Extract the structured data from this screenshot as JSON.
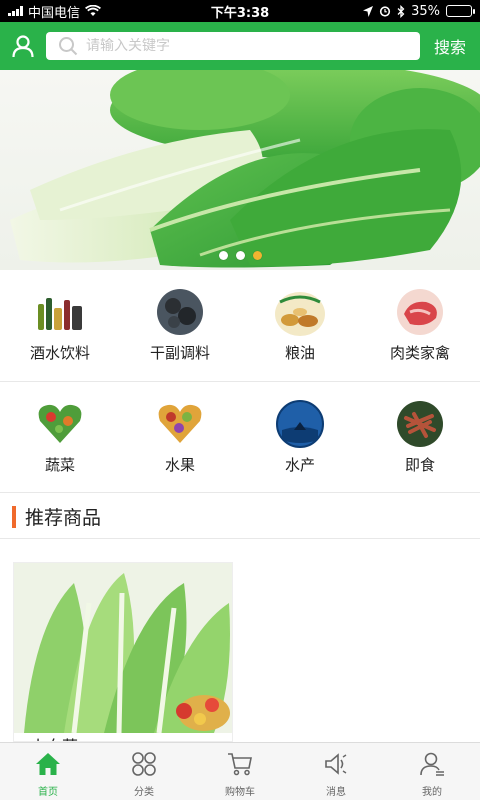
{
  "status_bar": {
    "carrier": "中国电信",
    "time": "下午3:38",
    "battery": "35%",
    "battery_level": 0.35,
    "icons": [
      "signal-icon",
      "wifi-icon",
      "location-icon",
      "alarm-icon",
      "bluetooth-icon",
      "battery-icon"
    ]
  },
  "header": {
    "search_placeholder": "请输入关键字",
    "search_button": "搜索",
    "accent_color": "#2ab24a"
  },
  "banner": {
    "slide_count": 3,
    "active_slide": 3
  },
  "categories": [
    {
      "label": "酒水饮料",
      "icon": "drinks-icon"
    },
    {
      "label": "干副调料",
      "icon": "dried-goods-icon"
    },
    {
      "label": "粮油",
      "icon": "grain-oil-icon"
    },
    {
      "label": "肉类家禽",
      "icon": "meat-icon"
    },
    {
      "label": "蔬菜",
      "icon": "vegetables-icon"
    },
    {
      "label": "水果",
      "icon": "fruit-icon"
    },
    {
      "label": "水产",
      "icon": "seafood-icon"
    },
    {
      "label": "即食",
      "icon": "ready-food-icon"
    }
  ],
  "section": {
    "title": "推荐商品",
    "accent_color": "#f06a2c"
  },
  "products": [
    {
      "name": "小白菜"
    }
  ],
  "tabs": [
    {
      "label": "首页",
      "icon": "home-icon",
      "active": true
    },
    {
      "label": "分类",
      "icon": "category-icon",
      "active": false
    },
    {
      "label": "购物车",
      "icon": "cart-icon",
      "active": false
    },
    {
      "label": "消息",
      "icon": "message-icon",
      "active": false
    },
    {
      "label": "我的",
      "icon": "profile-icon",
      "active": false
    }
  ]
}
